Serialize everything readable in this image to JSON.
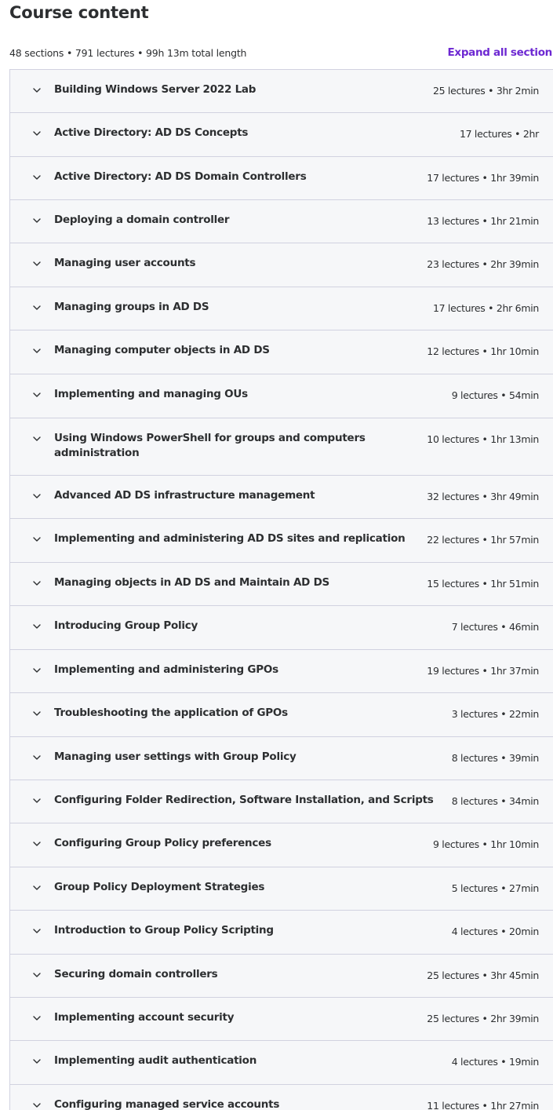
{
  "header": {
    "title": "Course content",
    "summary": "48 sections • 791 lectures • 99h 13m total length",
    "expand_label": "Expand all section"
  },
  "sections": [
    {
      "title": "Building Windows Server 2022 Lab",
      "meta": "25 lectures • 3hr 2min"
    },
    {
      "title": "Active Directory: AD DS Concepts",
      "meta": "17 lectures • 2hr"
    },
    {
      "title": "Active Directory: AD DS Domain Controllers",
      "meta": "17 lectures • 1hr 39min"
    },
    {
      "title": "Deploying a domain controller",
      "meta": "13 lectures • 1hr 21min"
    },
    {
      "title": "Managing user accounts",
      "meta": "23 lectures • 2hr 39min"
    },
    {
      "title": "Managing groups in AD DS",
      "meta": "17 lectures • 2hr 6min"
    },
    {
      "title": "Managing computer objects in AD DS",
      "meta": "12 lectures • 1hr 10min"
    },
    {
      "title": "Implementing and managing OUs",
      "meta": "9 lectures • 54min"
    },
    {
      "title": "Using Windows PowerShell for groups and computers administration",
      "meta": "10 lectures • 1hr 13min"
    },
    {
      "title": "Advanced AD DS infrastructure management",
      "meta": "32 lectures • 3hr 49min"
    },
    {
      "title": "Implementing and administering AD DS sites and replication",
      "meta": "22 lectures • 1hr 57min"
    },
    {
      "title": "Managing objects in AD DS and Maintain AD DS",
      "meta": "15 lectures • 1hr 51min"
    },
    {
      "title": "Introducing Group Policy",
      "meta": "7 lectures • 46min"
    },
    {
      "title": "Implementing and administering GPOs",
      "meta": "19 lectures • 1hr 37min"
    },
    {
      "title": "Troubleshooting the application of GPOs",
      "meta": "3 lectures • 22min"
    },
    {
      "title": "Managing user settings with Group Policy",
      "meta": "8 lectures • 39min"
    },
    {
      "title": "Configuring Folder Redirection, Software Installation, and Scripts",
      "meta": "8 lectures • 34min"
    },
    {
      "title": "Configuring Group Policy preferences",
      "meta": "9 lectures • 1hr 10min"
    },
    {
      "title": "Group Policy Deployment Strategies",
      "meta": "5 lectures • 27min"
    },
    {
      "title": "Introduction to Group Policy Scripting",
      "meta": "4 lectures • 20min"
    },
    {
      "title": "Securing domain controllers",
      "meta": "25 lectures • 3hr 45min"
    },
    {
      "title": "Implementing account security",
      "meta": "25 lectures • 2hr 39min"
    },
    {
      "title": "Implementing audit authentication",
      "meta": "4 lectures • 19min"
    },
    {
      "title": "Configuring managed service accounts",
      "meta": "11 lectures • 1hr 27min"
    }
  ],
  "icons": {
    "section_toggle": "chevron-down-icon"
  },
  "colors": {
    "accent": "#6d28d2",
    "section_bg": "#f6f7f9",
    "border": "#d1d2e0",
    "text": "#2d2f31"
  }
}
